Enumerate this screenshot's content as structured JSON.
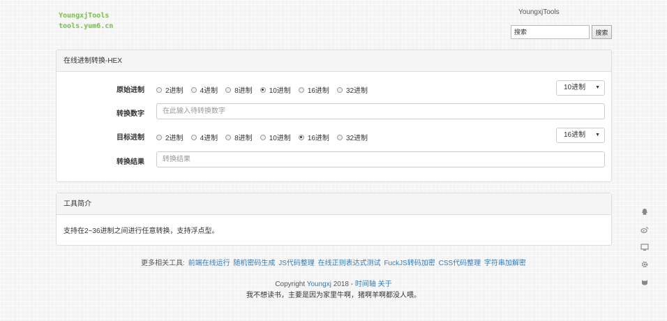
{
  "header": {
    "logo_line1": "YoungxjTools",
    "logo_line2": "tools.yum6.cn",
    "site_name": "YoungxjTools",
    "search_placeholder": "搜索",
    "search_button": "搜索"
  },
  "converter": {
    "title": "在线进制转换-HEX",
    "source_label": "原始进制",
    "number_label": "转换数字",
    "target_label": "目标进制",
    "result_label": "转换结果",
    "radix_options": [
      "2进制",
      "4进制",
      "8进制",
      "10进制",
      "16进制",
      "32进制"
    ],
    "source_selected_index": 3,
    "target_selected_index": 4,
    "source_select_value": "10进制",
    "target_select_value": "16进制",
    "number_placeholder": "在此输入待转换数字",
    "result_placeholder": "转换结果"
  },
  "intro": {
    "title": "工具简介",
    "body": "支持在2~36进制之间进行任意转换，支持浮点型。"
  },
  "footer": {
    "more_tools_label": "更多相关工具:",
    "more_tools": [
      "前端在线运行",
      "随机密码生成",
      "JS代码整理",
      "在线正则表达式测试",
      "FuckJS转码加密",
      "CSS代码整理",
      "字符串加解密"
    ],
    "copyright_prefix": "Copyright",
    "author": "Youngxj",
    "year": "2018 -",
    "timeline_link": "时间轴",
    "about_link": "关于",
    "note": "我不想读书，主要是因为家里牛啊，猪啊羊啊都没人喂。"
  },
  "side_icons": [
    "qq-icon",
    "weibo-icon",
    "monitor-icon",
    "gear-icon",
    "github-icon"
  ]
}
